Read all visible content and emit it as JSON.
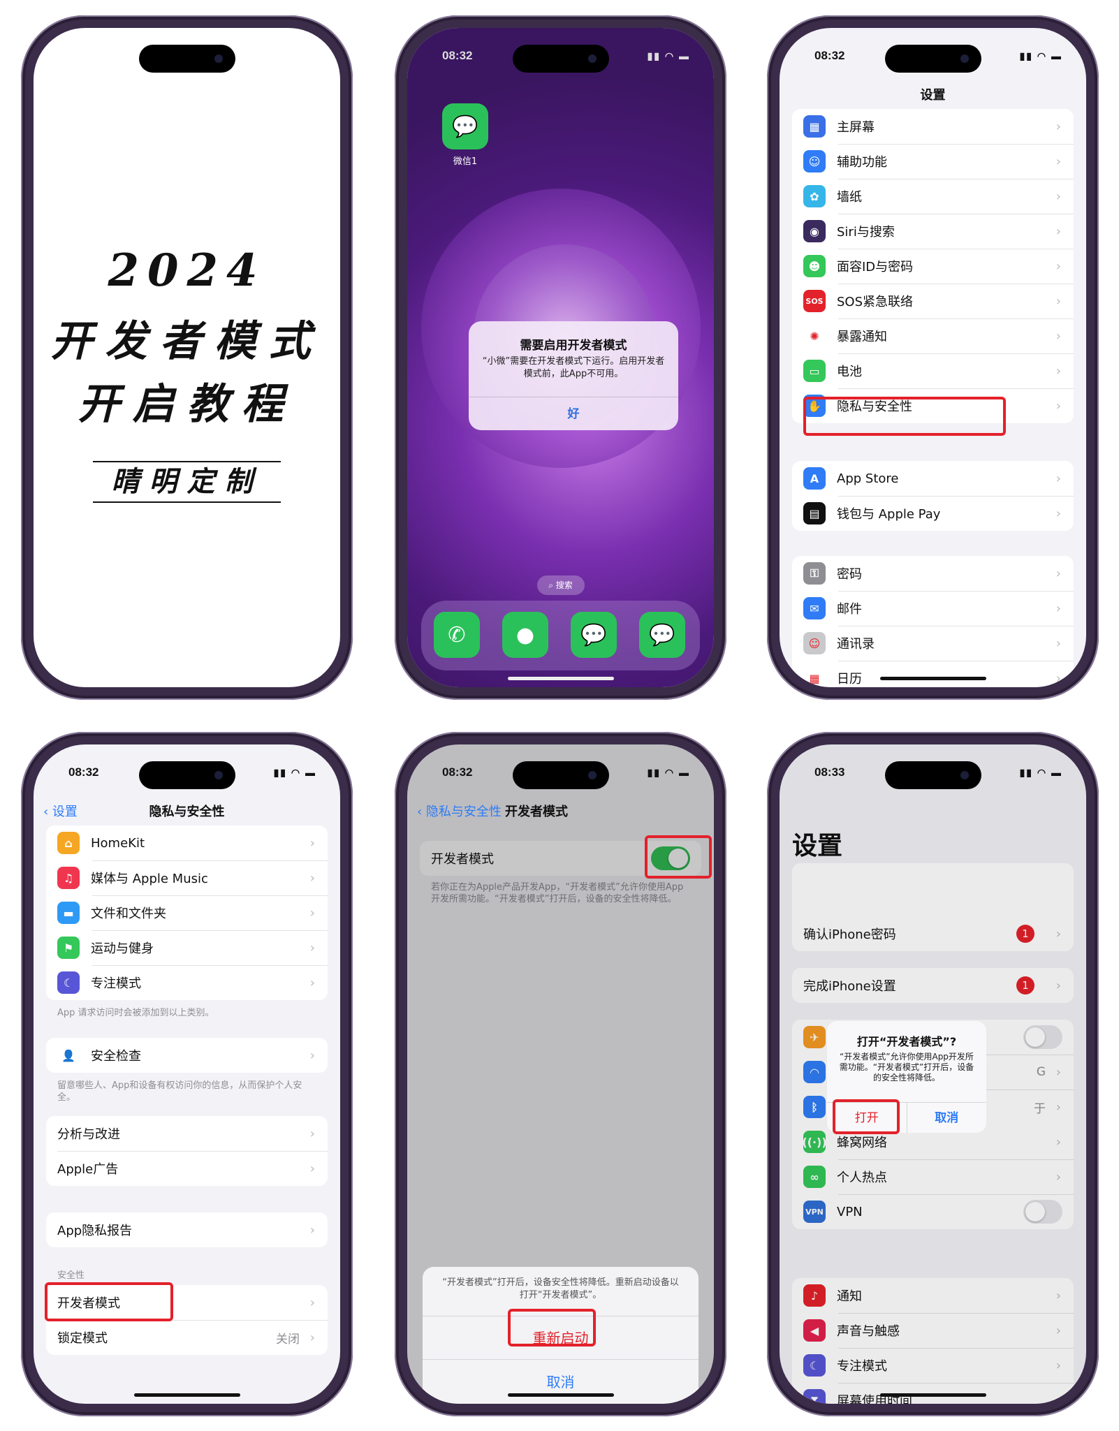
{
  "phone1": {
    "year": "2024",
    "line1": "开发者模式",
    "line2": "开启教程",
    "subtitle": "晴明定制"
  },
  "phone2": {
    "time": "08:32",
    "app_label": "微信1",
    "alert_title": "需要启用开发者模式",
    "alert_message": "“小微”需要在开发者模式下运行。启用开发者模式前，此App不可用。",
    "alert_ok": "好",
    "search_label": "搜索"
  },
  "phone3": {
    "time": "08:32",
    "title": "设置",
    "group1": [
      {
        "label": "主屏幕",
        "icon": "home-screen-icon",
        "color": "#3a6fe6"
      },
      {
        "label": "辅助功能",
        "icon": "accessibility-icon",
        "color": "#2f7cf6"
      },
      {
        "label": "墙纸",
        "icon": "wallpaper-icon",
        "color": "#36b6e8"
      },
      {
        "label": "Siri与搜索",
        "icon": "siri-icon",
        "color": "#3a2a5e"
      },
      {
        "label": "面容ID与密码",
        "icon": "face-id-icon",
        "color": "#34c759"
      },
      {
        "label": "SOS紧急联络",
        "icon": "sos-icon",
        "color": "#e3212a"
      },
      {
        "label": "暴露通知",
        "icon": "exposure-icon",
        "color": "#ffffff"
      },
      {
        "label": "电池",
        "icon": "battery-icon",
        "color": "#34c759"
      },
      {
        "label": "隐私与安全性",
        "icon": "privacy-hand-icon",
        "color": "#2f7cf6"
      }
    ],
    "group2": [
      {
        "label": "App Store",
        "icon": "app-store-icon",
        "color": "#2f7cf6"
      },
      {
        "label": "钱包与 Apple Pay",
        "icon": "wallet-icon",
        "color": "#111111"
      }
    ],
    "group3": [
      {
        "label": "密码",
        "icon": "key-icon",
        "color": "#8e8e93"
      },
      {
        "label": "邮件",
        "icon": "mail-icon",
        "color": "#2f7cf6"
      },
      {
        "label": "通讯录",
        "icon": "contacts-icon",
        "color": "#c9c9cc"
      },
      {
        "label": "日历",
        "icon": "calendar-icon",
        "color": "#ffffff"
      }
    ]
  },
  "phone4": {
    "time": "08:32",
    "back": "设置",
    "title": "隐私与安全性",
    "group1": [
      {
        "label": "HomeKit",
        "icon": "homekit-icon",
        "color": "#f5a623"
      },
      {
        "label": "媒体与 Apple Music",
        "icon": "music-icon",
        "color": "#f0364f"
      },
      {
        "label": "文件和文件夹",
        "icon": "folder-icon",
        "color": "#2f9af6"
      },
      {
        "label": "运动与健身",
        "icon": "fitness-icon",
        "color": "#34c759"
      },
      {
        "label": "专注模式",
        "icon": "focus-moon-icon",
        "color": "#5856d6"
      }
    ],
    "footnote1": "App 请求访问时会被添加到以上类别。",
    "safety_check": "安全检查",
    "footnote2": "留意哪些人、App和设备有权访问你的信息，从而保护个人安全。",
    "analytics": "分析与改进",
    "apple_ads": "Apple广告",
    "privacy_report": "App隐私报告",
    "security_header": "安全性",
    "developer_mode": "开发者模式",
    "lockdown_mode": "锁定模式",
    "lockdown_value": "关闭"
  },
  "phone5": {
    "time": "08:32",
    "back": "隐私与安全性",
    "title": "开发者模式",
    "row_label": "开发者模式",
    "footnote": "若你正在为Apple产品开发App，“开发者模式”允许你使用App开发所需功能。“开发者模式”打开后，设备的安全性将降低。",
    "sheet_message": "“开发者模式”打开后，设备安全性将降低。重新启动设备以打开“开发者模式”。",
    "restart": "重新启动",
    "cancel": "取消",
    "toggle_on": true
  },
  "phone6": {
    "time": "08:33",
    "large_title": "设置",
    "confirm_passcode": "确认iPhone密码",
    "finish_setup": "完成iPhone设置",
    "badge1": "1",
    "badge2": "1",
    "alert_title": "打开“开发者模式”?",
    "alert_message": "“开发者模式”允许你使用App开发所需功能。“开发者模式”打开后，设备的安全性将降低。",
    "open": "打开",
    "cancel": "取消",
    "partial_g": "G",
    "partial_f": "于",
    "group_net": [
      {
        "label": "蜂窝网络",
        "icon": "cellular-icon",
        "color": "#34c759"
      },
      {
        "label": "个人热点",
        "icon": "hotspot-icon",
        "color": "#34c759"
      },
      {
        "label": "VPN",
        "icon": "vpn-icon",
        "color": "#2f6fd6"
      }
    ],
    "group_notif": [
      {
        "label": "通知",
        "icon": "bell-icon",
        "color": "#e3212a"
      },
      {
        "label": "声音与触感",
        "icon": "speaker-icon",
        "color": "#e3214e"
      },
      {
        "label": "专注模式",
        "icon": "focus-moon-icon",
        "color": "#5856d6"
      },
      {
        "label": "屏幕使用时间",
        "icon": "hourglass-icon",
        "color": "#5856d6"
      }
    ]
  }
}
